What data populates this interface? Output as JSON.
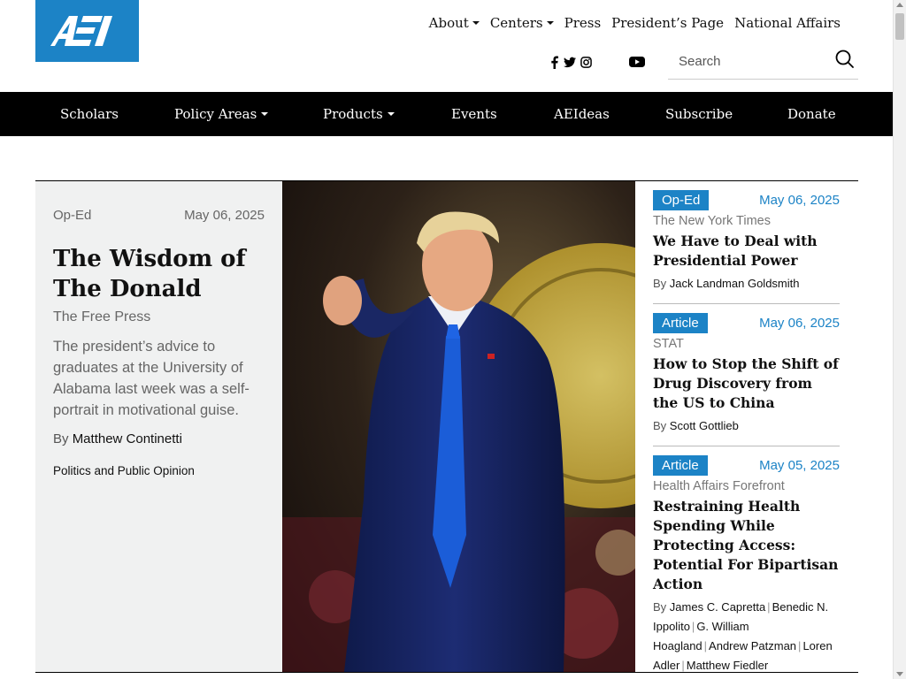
{
  "header": {
    "logo_text": "AEI",
    "top_nav": [
      {
        "label": "About",
        "dropdown": true
      },
      {
        "label": "Centers",
        "dropdown": true
      },
      {
        "label": "Press",
        "dropdown": false
      },
      {
        "label": "President’s Page",
        "dropdown": false
      },
      {
        "label": "National Affairs",
        "dropdown": false
      }
    ],
    "social_icons": [
      "facebook-icon",
      "twitter-icon",
      "instagram-icon",
      "youtube-icon"
    ],
    "search": {
      "placeholder": "Search",
      "value": ""
    }
  },
  "main_nav": [
    {
      "label": "Scholars",
      "dropdown": false
    },
    {
      "label": "Policy Areas",
      "dropdown": true
    },
    {
      "label": "Products",
      "dropdown": true
    },
    {
      "label": "Events",
      "dropdown": false
    },
    {
      "label": "AEIdeas",
      "dropdown": false
    },
    {
      "label": "Subscribe",
      "dropdown": false
    },
    {
      "label": "Donate",
      "dropdown": false
    }
  ],
  "feature": {
    "type": "Op-Ed",
    "date": "May 06, 2025",
    "title": "The Wisdom of The Donald",
    "source": "The Free Press",
    "description": "The president’s advice to graduates at the University of Alabama last week was a self-portrait in motivational guise.",
    "by_label": "By",
    "author": "Matthew Continetti",
    "topic": "Politics and Public Opinion"
  },
  "side": [
    {
      "type": "Op-Ed",
      "date": "May 06, 2025",
      "source": "The New York Times",
      "title": "We Have to Deal with Presidential Power",
      "by_label": "By",
      "authors": [
        "Jack Landman Goldsmith"
      ]
    },
    {
      "type": "Article",
      "date": "May 06, 2025",
      "source": "STAT",
      "title": "How to Stop the Shift of Drug Discovery from the US to China",
      "by_label": "By",
      "authors": [
        "Scott Gottlieb"
      ]
    },
    {
      "type": "Article",
      "date": "May 05, 2025",
      "source": "Health Affairs Forefront",
      "title": "Restraining Health Spending While Protecting Access: Potential For Bipartisan Action",
      "by_label": "By",
      "authors": [
        "James C. Capretta",
        "Benedic N. Ippolito",
        "G. William Hoagland",
        "Andrew Patzman",
        "Loren Adler",
        "Matthew Fiedler"
      ]
    }
  ],
  "colors": {
    "brand": "#1c83c6",
    "nav_bg": "#000000",
    "feature_bg": "#f0f1f1"
  }
}
